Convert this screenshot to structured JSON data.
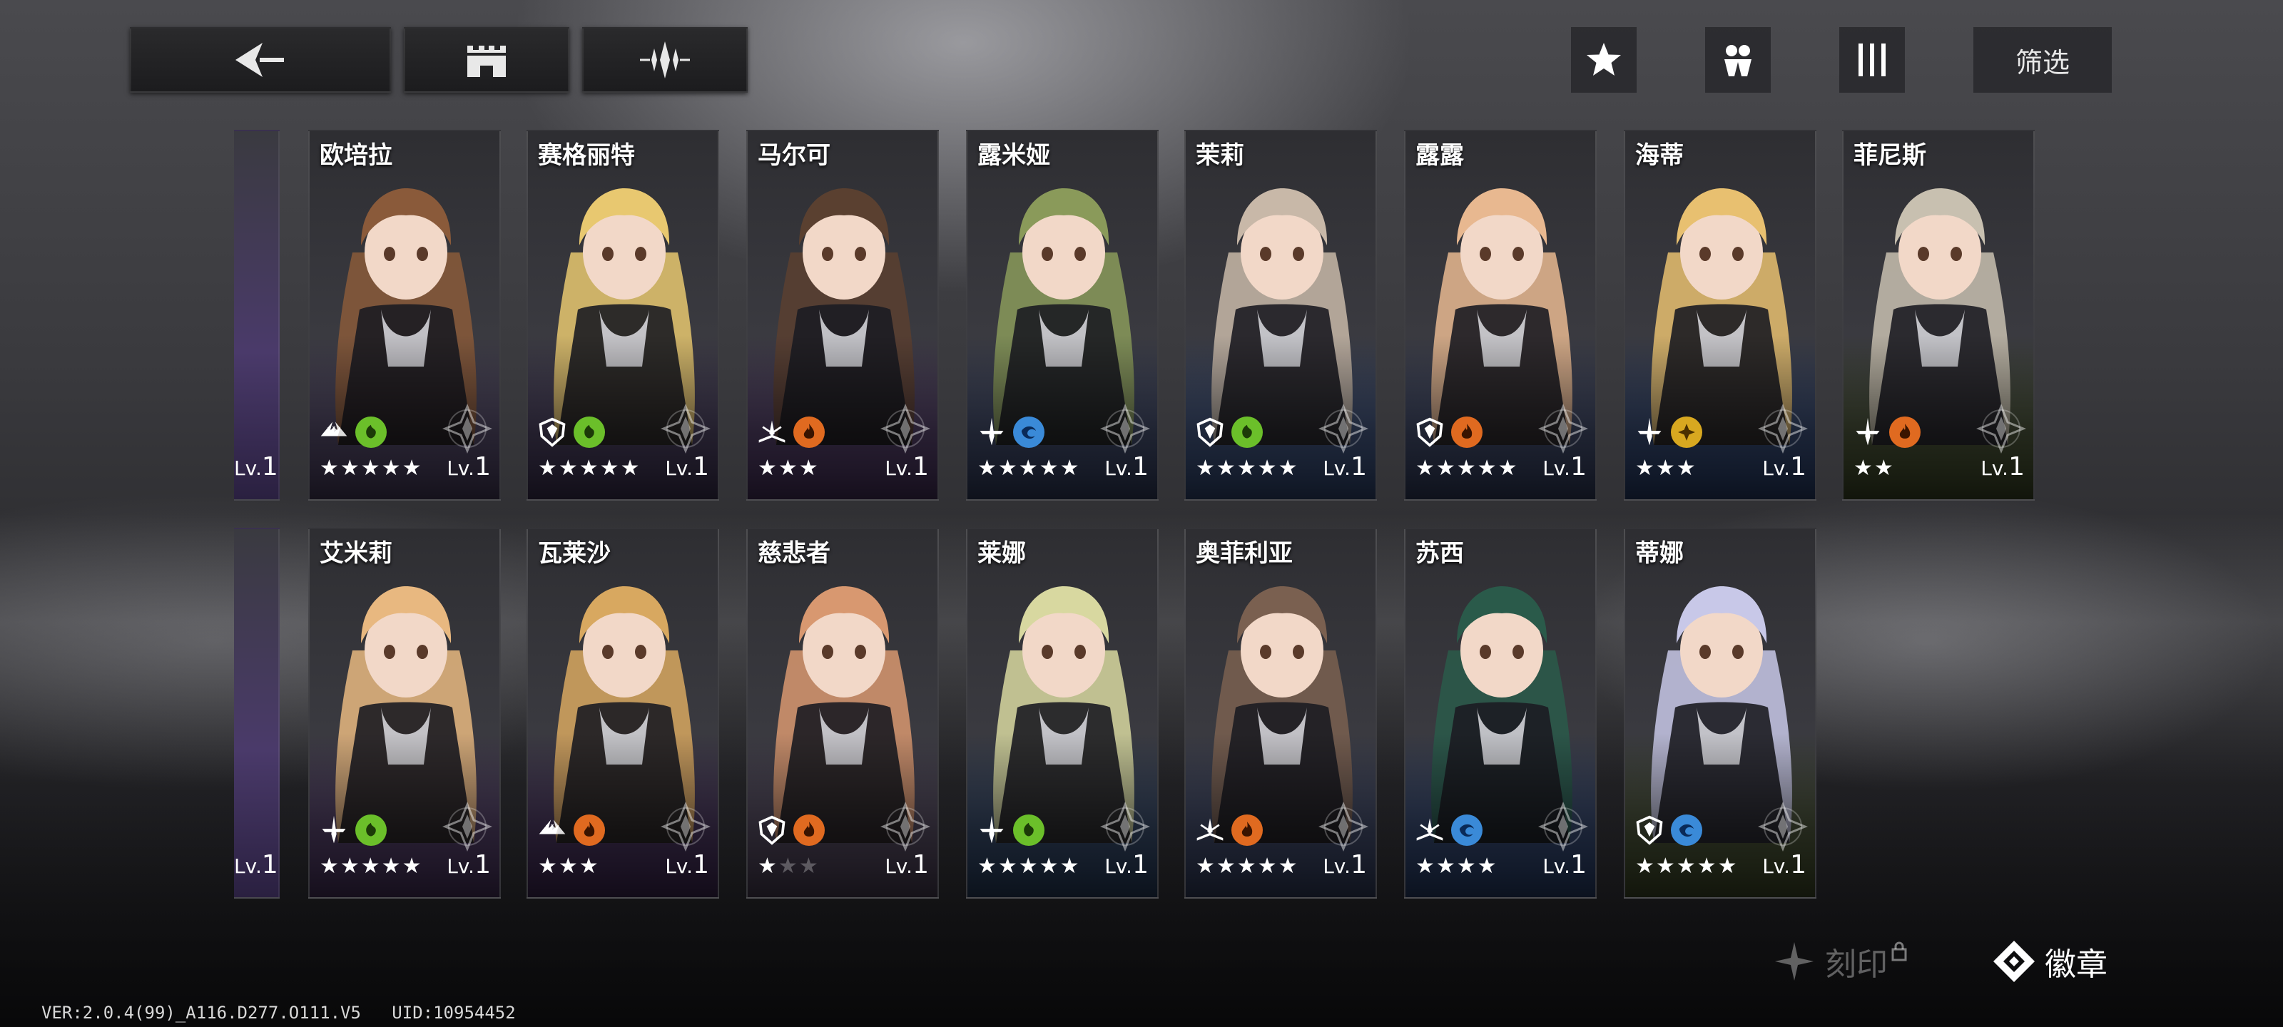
{
  "top_bar": {
    "back_icon": "back-arrow-icon",
    "base_icon": "castle-icon",
    "switch_icon": "crystal-icon",
    "favorite_icon": "star-icon",
    "team_icon": "team-icon",
    "sort_icon": "columns-icon",
    "filter_label": "筛选"
  },
  "characters_row1": [
    {
      "name": "欧培拉",
      "stars": 5,
      "max_stars": 5,
      "level_prefix": "Lv.",
      "level": "1",
      "class_icon": "class-icon-winged",
      "element": "toxic",
      "element_color": "#6bbf2a",
      "art_color": "#6a5a8a",
      "hair": "#8a5a3a"
    },
    {
      "name": "赛格丽特",
      "stars": 5,
      "max_stars": 5,
      "level_prefix": "Lv.",
      "level": "1",
      "class_icon": "class-icon-shield",
      "element": "toxic",
      "element_color": "#6bbf2a",
      "art_color": "#5a4a7a",
      "hair": "#e8c870"
    },
    {
      "name": "马尔可",
      "stars": 3,
      "max_stars": 3,
      "level_prefix": "Lv.",
      "level": "1",
      "class_icon": "class-icon-book",
      "element": "fire",
      "element_color": "#e06a20",
      "art_color": "#6a4a8a",
      "hair": "#5a4030"
    },
    {
      "name": "露米娅",
      "stars": 5,
      "max_stars": 5,
      "level_prefix": "Lv.",
      "level": "1",
      "class_icon": "class-icon-sword",
      "element": "wind",
      "element_color": "#3a8ad8",
      "art_color": "#4a5a8a",
      "hair": "#8a9a5a"
    },
    {
      "name": "茉莉",
      "stars": 5,
      "max_stars": 5,
      "level_prefix": "Lv.",
      "level": "1",
      "class_icon": "class-icon-shield",
      "element": "toxic",
      "element_color": "#6bbf2a",
      "art_color": "#4a6aaa",
      "hair": "#c8b8a8"
    },
    {
      "name": "露露",
      "stars": 5,
      "max_stars": 5,
      "level_prefix": "Lv.",
      "level": "1",
      "class_icon": "class-icon-shield",
      "element": "fire",
      "element_color": "#e06a20",
      "art_color": "#4a5a8a",
      "hair": "#e8b890"
    },
    {
      "name": "海蒂",
      "stars": 3,
      "max_stars": 3,
      "level_prefix": "Lv.",
      "level": "1",
      "class_icon": "class-icon-sword",
      "element": "light",
      "element_color": "#d8a820",
      "art_color": "#3a5a9a",
      "hair": "#e8c070"
    },
    {
      "name": "菲尼斯",
      "stars": 2,
      "max_stars": 2,
      "level_prefix": "Lv.",
      "level": "1",
      "class_icon": "class-icon-sword",
      "element": "fire",
      "element_color": "#e06a20",
      "art_color": "#5a6a3a",
      "hair": "#c8c0b0"
    }
  ],
  "characters_row2": [
    {
      "name": "艾米莉",
      "stars": 5,
      "max_stars": 5,
      "level_prefix": "Lv.",
      "level": "1",
      "class_icon": "class-icon-sword",
      "element": "toxic",
      "element_color": "#6bbf2a",
      "art_color": "#6a4a8a",
      "hair": "#e8b880"
    },
    {
      "name": "瓦莱沙",
      "stars": 3,
      "max_stars": 3,
      "level_prefix": "Lv.",
      "level": "1",
      "class_icon": "class-icon-winged",
      "element": "fire",
      "element_color": "#e06a20",
      "art_color": "#5a3a7a",
      "hair": "#d8a860"
    },
    {
      "name": "慈悲者",
      "stars": 1,
      "max_stars": 3,
      "level_prefix": "Lv.",
      "level": "1",
      "class_icon": "class-icon-shield",
      "element": "fire",
      "element_color": "#e06a20",
      "art_color": "#6a5a7a",
      "hair": "#d89870"
    },
    {
      "name": "莱娜",
      "stars": 5,
      "max_stars": 5,
      "level_prefix": "Lv.",
      "level": "1",
      "class_icon": "class-icon-sword",
      "element": "toxic",
      "element_color": "#6bbf2a",
      "art_color": "#3a5a8a",
      "hair": "#d8d8a0"
    },
    {
      "name": "奥菲利亚",
      "stars": 5,
      "max_stars": 5,
      "level_prefix": "Lv.",
      "level": "1",
      "class_icon": "class-icon-book",
      "element": "fire",
      "element_color": "#e06a20",
      "art_color": "#4a5a8a",
      "hair": "#7a6050"
    },
    {
      "name": "苏西",
      "stars": 4,
      "max_stars": 4,
      "level_prefix": "Lv.",
      "level": "1",
      "class_icon": "class-icon-book",
      "element": "wind",
      "element_color": "#3a8ad8",
      "art_color": "#3a5a9a",
      "hair": "#2a5a4a"
    },
    {
      "name": "蒂娜",
      "stars": 5,
      "max_stars": 5,
      "level_prefix": "Lv.",
      "level": "1",
      "class_icon": "class-icon-shield",
      "element": "wind",
      "element_color": "#3a8ad8",
      "art_color": "#5a6a3a",
      "hair": "#c8c8e8"
    }
  ],
  "partial_cards": [
    {
      "level_prefix": "Lv.",
      "level": "1"
    },
    {
      "level_prefix": "Lv.",
      "level": "1"
    }
  ],
  "bottom": {
    "engrave_label": "刻印",
    "badge_label": "徽章"
  },
  "version_text": "VER:2.0.4(99)_A116.D277.O111.V5",
  "uid_text": "UID:10954452"
}
